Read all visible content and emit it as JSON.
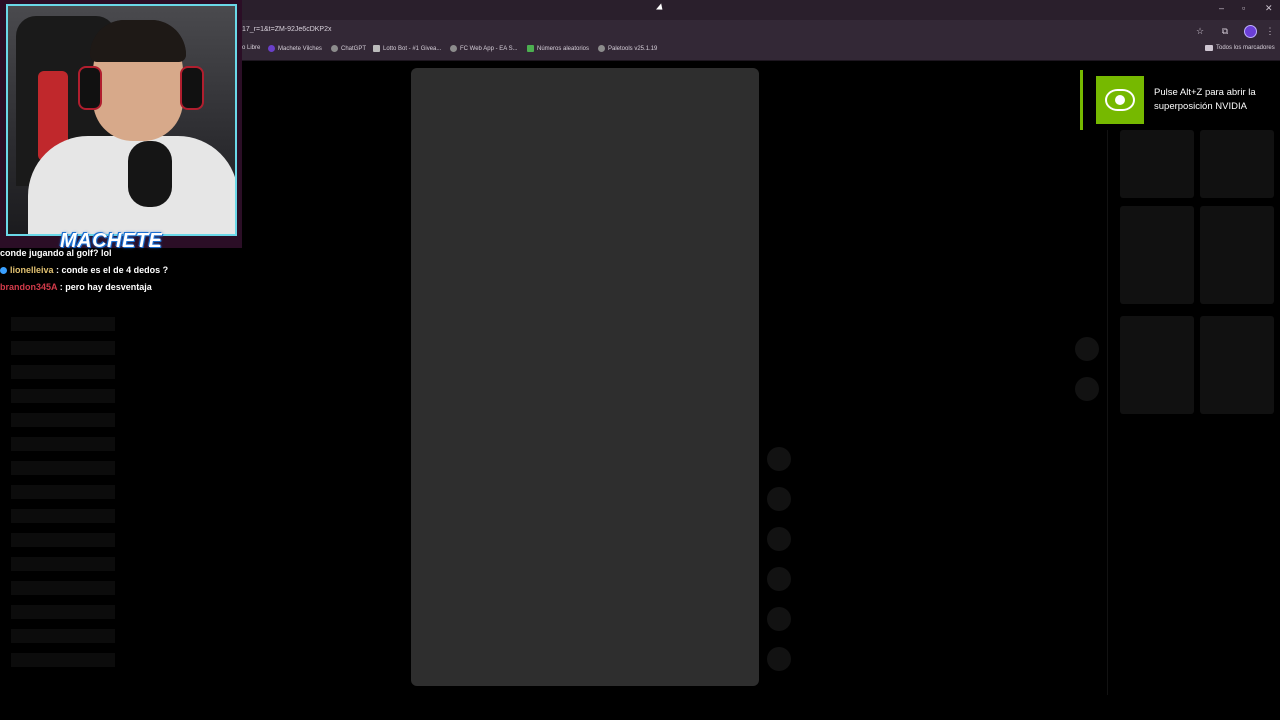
{
  "browser": {
    "url": "17_r=1&t=ZM-92Je6cDKP2x",
    "bookmarks": [
      {
        "label": "o Libre",
        "icon": "none"
      },
      {
        "label": "Machete Vilches",
        "icon": "purple"
      },
      {
        "label": "ChatGPT",
        "icon": "openai"
      },
      {
        "label": "Lotto Bot - #1 Givea...",
        "icon": "grid"
      },
      {
        "label": "FC Web App - EA S...",
        "icon": "globe"
      },
      {
        "label": "Números aleatorios",
        "icon": "clover"
      },
      {
        "label": "Paletools v25.1.19",
        "icon": "globe"
      }
    ],
    "all_bookmarks": "Todos los marcadores",
    "controls": {
      "minimize": "–",
      "maximize": "▫",
      "close": "✕"
    },
    "icons": {
      "star": "☆",
      "extensions": "⧉",
      "menu": "⋮"
    }
  },
  "stream": {
    "streamer_name": "MACHETE",
    "chat": [
      {
        "user": "",
        "message": "conde jugando al golf? lol"
      },
      {
        "user": "lionelleiva",
        "message": ": conde es el de 4 dedos ?"
      },
      {
        "user": "brandon345A",
        "message": ": pero hay desventaja"
      }
    ]
  },
  "notification": {
    "text_line1": "Pulse Alt+Z para abrir la",
    "text_line2": "superposición NVIDIA",
    "accent": "#76b900"
  }
}
